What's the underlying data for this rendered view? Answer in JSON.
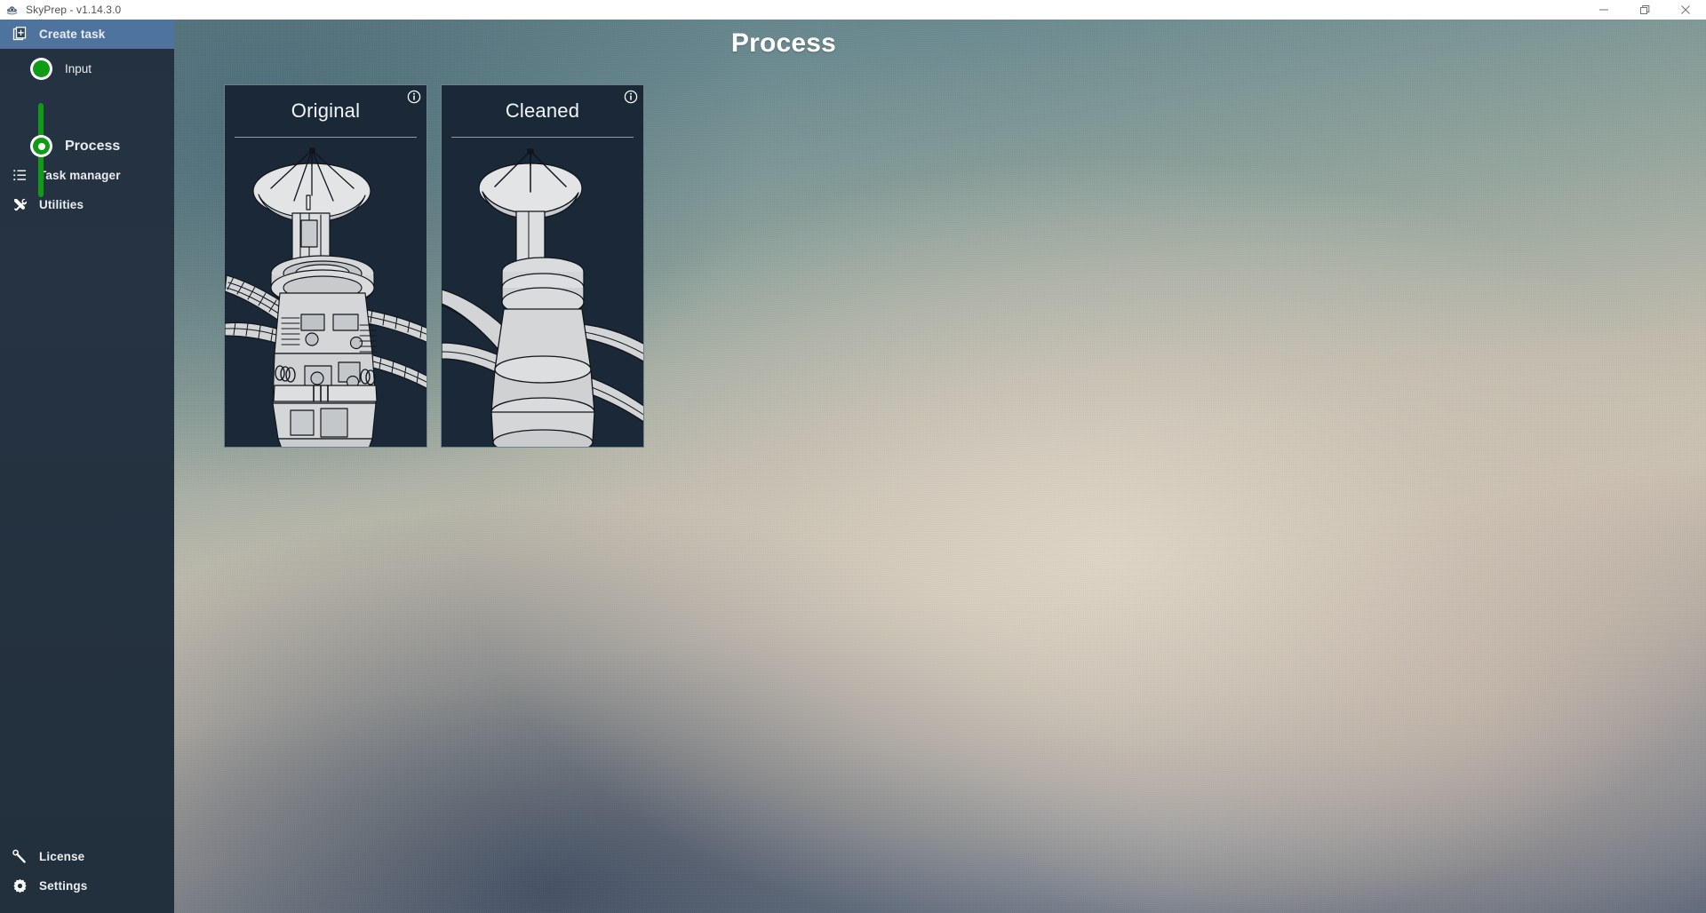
{
  "window": {
    "title": "SkyPrep - v1.14.3.0",
    "app_icon": "cloud-eye-icon",
    "controls": {
      "minimize": "minimize-icon",
      "restore": "restore-icon",
      "close": "close-icon"
    }
  },
  "sidebar": {
    "primary_items": [
      {
        "id": "create-task",
        "label": "Create task",
        "icon": "new-document-icon",
        "active": true
      }
    ],
    "stepper": {
      "steps": [
        {
          "id": "input",
          "label": "Input",
          "state": "completed",
          "current": false
        },
        {
          "id": "process",
          "label": "Process",
          "state": "active",
          "current": true
        }
      ],
      "accent_color": "#0f9b14"
    },
    "secondary_items": [
      {
        "id": "task-manager",
        "label": "Task manager",
        "icon": "list-icon",
        "active": false
      },
      {
        "id": "utilities",
        "label": "Utilities",
        "icon": "tools-icon",
        "active": false
      }
    ],
    "bottom_items": [
      {
        "id": "license",
        "label": "License",
        "icon": "key-icon",
        "active": false
      },
      {
        "id": "settings",
        "label": "Settings",
        "icon": "gear-icon",
        "active": false
      }
    ],
    "active_color": "#4f739f",
    "background_color": "#243140"
  },
  "main": {
    "title": "Process",
    "cards": [
      {
        "id": "original",
        "title": "Original",
        "info_icon": "info-icon",
        "image_alt": "satellite-line-art-detailed"
      },
      {
        "id": "cleaned",
        "title": "Cleaned",
        "info_icon": "info-icon",
        "image_alt": "satellite-line-art-simplified"
      }
    ],
    "card_background_color": "#1b2838",
    "card_border_color": "#6e8389"
  }
}
